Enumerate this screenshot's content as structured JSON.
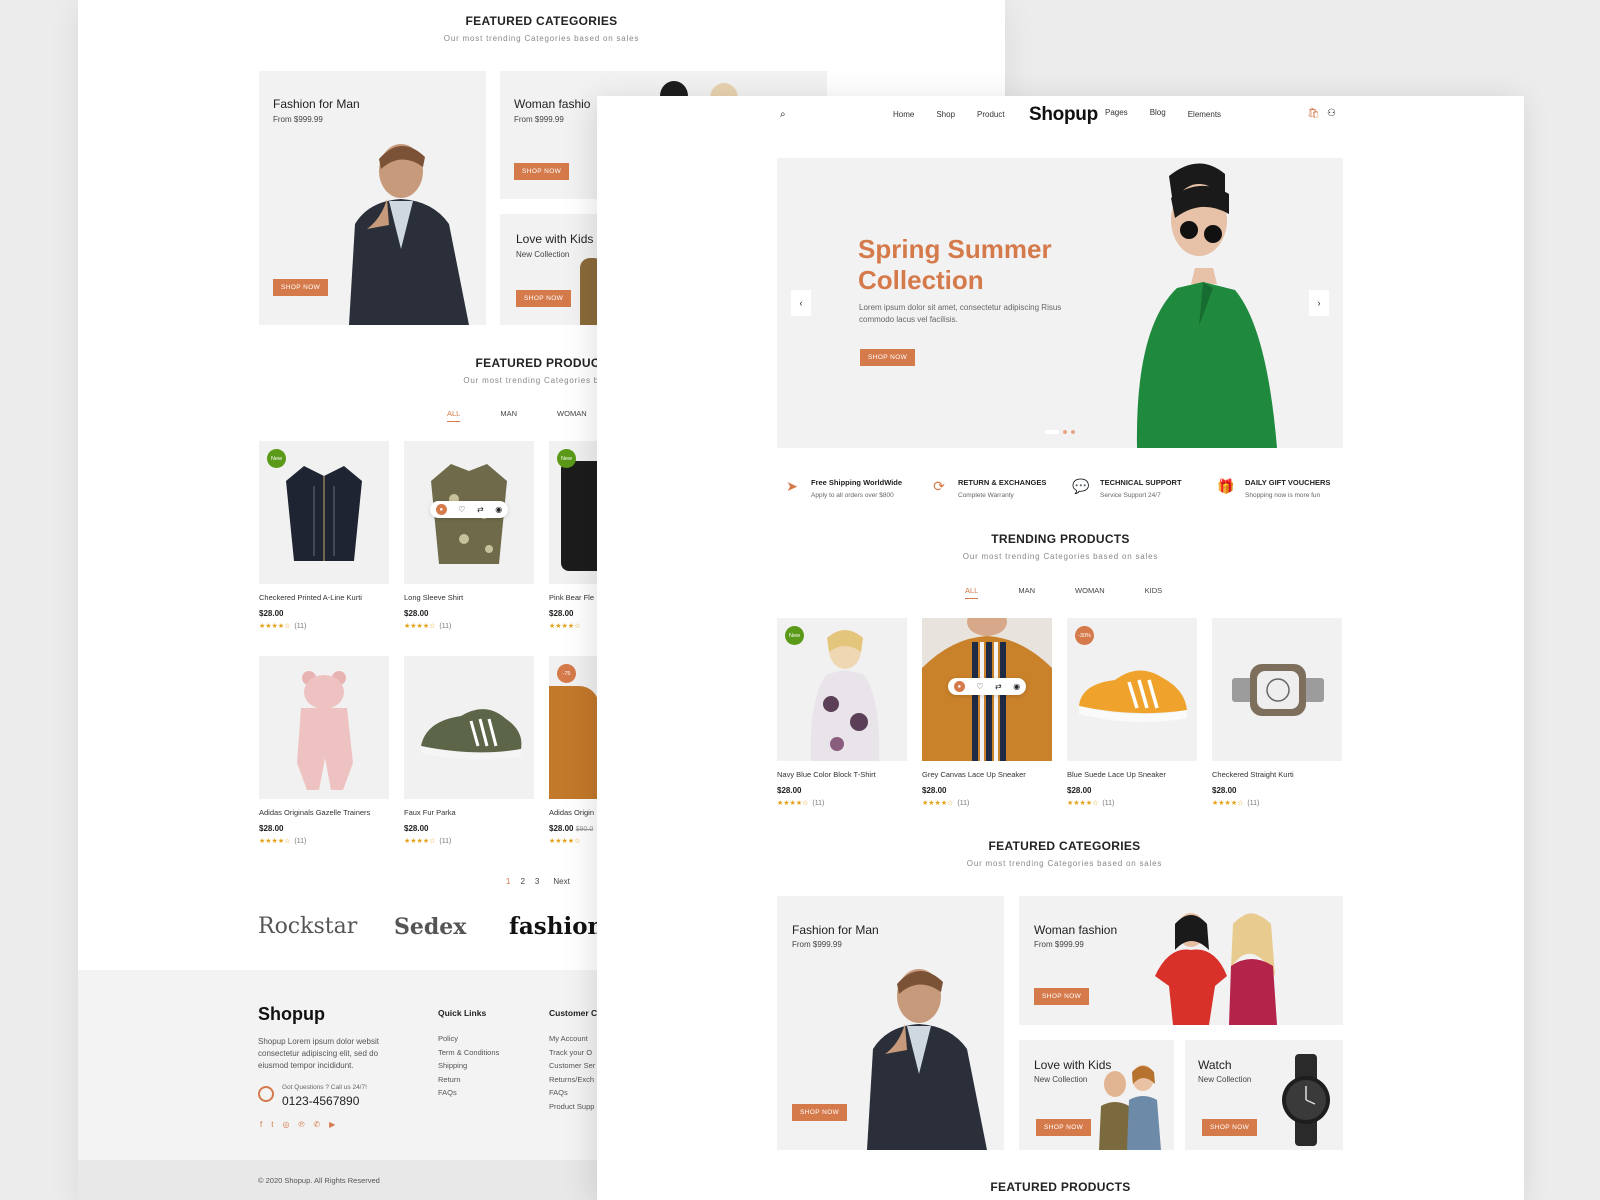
{
  "colors": {
    "accent": "#d57a4b",
    "badge_new": "#5a9a18",
    "star": "#e3a21a"
  },
  "back": {
    "featured_categories": {
      "title": "FEATURED CATEGORIES",
      "subtitle": "Our most trending Categories based on sales",
      "cards": [
        {
          "name": "Fashion for Man",
          "sub": "From $999.99",
          "button": "SHOP NOW"
        },
        {
          "name": "Woman fashio",
          "sub": "From $999.99",
          "button": "SHOP NOW"
        },
        {
          "name": "Love with Kids",
          "sub": "New Collection",
          "button": "SHOP NOW"
        }
      ]
    },
    "featured_products": {
      "title": "FEATURED PRODUCT",
      "subtitle": "Our most trending Categories based",
      "tabs": [
        "ALL",
        "MAN",
        "WOMAN"
      ],
      "products": [
        {
          "name": "Checkered Printed A-Line Kurti",
          "price": "$28.00",
          "rating": "★★★★☆",
          "count": "(11)",
          "badge": "New"
        },
        {
          "name": "Long Sleeve Shirt",
          "price": "$28.00",
          "rating": "★★★★☆",
          "count": "(11)",
          "badge": ""
        },
        {
          "name": "Pink Bear Fle",
          "price": "$28.00",
          "rating": "★★★★☆",
          "count": "",
          "badge": "New"
        },
        {
          "name": "Adidas Originals Gazelle Trainers",
          "price": "$28.00",
          "rating": "★★★★☆",
          "count": "(11)",
          "badge": ""
        },
        {
          "name": "Faux Fur Parka",
          "price": "$28.00",
          "rating": "★★★★☆",
          "count": "(11)",
          "badge": ""
        },
        {
          "name": "Adidas Origin",
          "price": "$28.00",
          "old_price": "$90.0",
          "rating": "★★★★☆",
          "count": "",
          "badge": "-75"
        }
      ]
    },
    "pagination": [
      "1",
      "2",
      "3",
      "Next"
    ],
    "brands": [
      "Rockstar",
      "Sedex",
      "fashion"
    ],
    "footer": {
      "logo": "Shopup",
      "about": "Shopup Lorem ipsum dolor websit consectetur adipiscing elit, sed do eiusmod tempor incididunt.",
      "call_label": "Got Questions ? Call us 24/7!",
      "phone": "0123-4567890",
      "quick_links_title": "Quick Links",
      "quick_links": [
        "Policy",
        "Term & Conditions",
        "Shipping",
        "Return",
        "FAQs"
      ],
      "customer_title": "Customer Ca",
      "customer_links": [
        "My Account",
        "Track your O",
        "Customer Ser",
        "Returns/Exch",
        "FAQs",
        "Product Supp"
      ],
      "copyright": "© 2020 Shopup. All Rights Reserved"
    }
  },
  "front": {
    "nav": {
      "logo": "Shopup",
      "left_links": [
        "Home",
        "Shop",
        "Product"
      ],
      "right_links": [
        "Pages",
        "Blog",
        "Elements"
      ]
    },
    "hero": {
      "title": "Spring Summer Collection",
      "text": "Lorem ipsum dolor sit amet, consectetur adipiscing Risus commodo  lacus vel facilisis.",
      "button": "SHOP NOW"
    },
    "features": [
      {
        "icon": "paper-plane-icon",
        "title": "Free Shipping WorldWide",
        "sub": "Apply to all orders over $800"
      },
      {
        "icon": "refresh-icon",
        "title": "RETURN & EXCHANGES",
        "sub": "Complete Warranty"
      },
      {
        "icon": "chat-icon",
        "title": "TECHNICAL SUPPORT",
        "sub": "Service Support 24/7"
      },
      {
        "icon": "gift-icon",
        "title": "DAILY GIFT VOUCHERS",
        "sub": "Shopping now is more fun"
      }
    ],
    "trending": {
      "title": "TRENDING PRODUCTS",
      "subtitle": "Our most trending Categories based on sales",
      "tabs": [
        "ALL",
        "MAN",
        "WOMAN",
        "KIDS"
      ],
      "products": [
        {
          "name": "Navy Blue Color Block T-Shirt",
          "price": "$28.00",
          "rating": "★★★★☆",
          "count": "(11)",
          "badge": "New"
        },
        {
          "name": "Grey Canvas Lace Up Sneaker",
          "price": "$28.00",
          "rating": "★★★★☆",
          "count": "(11)",
          "badge": ""
        },
        {
          "name": "Blue Suede Lace Up Sneaker",
          "price": "$28.00",
          "rating": "★★★★☆",
          "count": "(11)",
          "badge": "-30%"
        },
        {
          "name": "Checkered Straight Kurti",
          "price": "$28.00",
          "rating": "★★★★☆",
          "count": "(11)",
          "badge": ""
        }
      ]
    },
    "featured_categories": {
      "title": "FEATURED CATEGORIES",
      "subtitle": "Our most trending Categories based on sales",
      "cards": [
        {
          "name": "Fashion for Man",
          "sub": "From $999.99",
          "button": "SHOP NOW"
        },
        {
          "name": "Woman fashion",
          "sub": "From $999.99",
          "button": "SHOP NOW"
        },
        {
          "name": "Love with Kids",
          "sub": "New Collection",
          "button": "SHOP NOW"
        },
        {
          "name": "Watch",
          "sub": "New Collection",
          "button": "SHOP NOW"
        }
      ]
    },
    "featured_products_title": "FEATURED PRODUCTS"
  }
}
